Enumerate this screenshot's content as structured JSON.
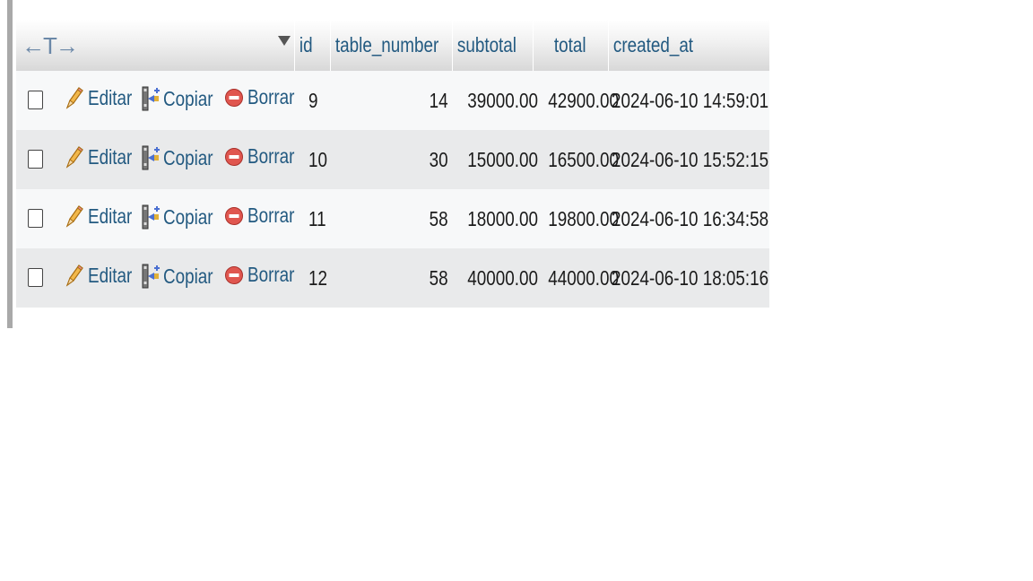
{
  "table": {
    "nav_arrows": "←T→",
    "headers": {
      "id": "id",
      "table_number": "table_number",
      "subtotal": "subtotal",
      "total": "total",
      "created_at": "created_at"
    },
    "actions": {
      "edit_label": "Editar",
      "copy_label": "Copiar",
      "delete_label": "Borrar"
    },
    "rows": [
      {
        "id": "9",
        "table_number": "14",
        "subtotal": "39000.00",
        "total": "42900.00",
        "created_at": "2024-06-10 14:59:01"
      },
      {
        "id": "10",
        "table_number": "30",
        "subtotal": "15000.00",
        "total": "16500.00",
        "created_at": "2024-06-10 15:52:15"
      },
      {
        "id": "11",
        "table_number": "58",
        "subtotal": "18000.00",
        "total": "19800.00",
        "created_at": "2024-06-10 16:34:58"
      },
      {
        "id": "12",
        "table_number": "58",
        "subtotal": "40000.00",
        "total": "44000.00",
        "created_at": "2024-06-10 18:05:16"
      }
    ]
  },
  "colors": {
    "link": "#235a81",
    "row_odd": "#f7f8f9",
    "row_even": "#e9eaeb",
    "delete_icon": "#e0564f",
    "pencil_icon": "#e8a83a"
  },
  "icons": [
    "pencil-icon",
    "copy-icon",
    "delete-icon",
    "sort-desc-icon"
  ]
}
